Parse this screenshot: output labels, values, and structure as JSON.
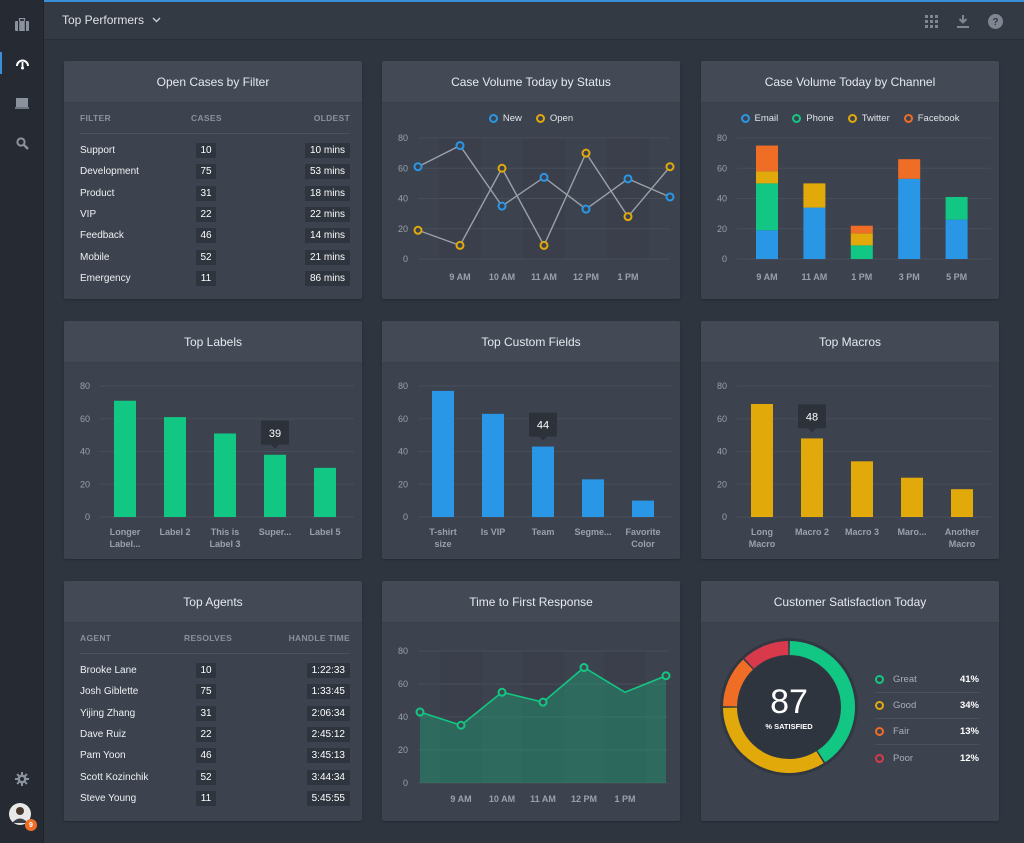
{
  "header": {
    "title": "Top Performers",
    "icons": [
      "grid-icon",
      "download-icon",
      "help-icon"
    ]
  },
  "sidebar": {
    "items": [
      {
        "name": "briefcase-icon",
        "active": false
      },
      {
        "name": "dashboard-gauge-icon",
        "active": true
      },
      {
        "name": "inbox-icon",
        "active": false
      },
      {
        "name": "search-icon",
        "active": false
      }
    ],
    "settings_icon": "gear-icon",
    "avatar_badge": "9"
  },
  "open_cases": {
    "title": "Open Cases by Filter",
    "columns": [
      "FILTER",
      "CASES",
      "OLDEST"
    ],
    "rows": [
      {
        "filter": "Support",
        "cases": "10",
        "oldest": "10 mins"
      },
      {
        "filter": "Development",
        "cases": "75",
        "oldest": "53 mins"
      },
      {
        "filter": "Product",
        "cases": "31",
        "oldest": "18 mins"
      },
      {
        "filter": "VIP",
        "cases": "22",
        "oldest": "22 mins"
      },
      {
        "filter": "Feedback",
        "cases": "46",
        "oldest": "14 mins"
      },
      {
        "filter": "Mobile",
        "cases": "52",
        "oldest": "21 mins"
      },
      {
        "filter": "Emergency",
        "cases": "11",
        "oldest": "86 mins"
      }
    ]
  },
  "top_agents": {
    "title": "Top Agents",
    "columns": [
      "AGENT",
      "RESOLVES",
      "HANDLE TIME"
    ],
    "rows": [
      {
        "agent": "Brooke Lane",
        "resolves": "10",
        "time": "1:22:33"
      },
      {
        "agent": "Josh Giblette",
        "resolves": "75",
        "time": "1:33:45"
      },
      {
        "agent": "Yijing Zhang",
        "resolves": "31",
        "time": "2:06:34"
      },
      {
        "agent": "Dave Ruiz",
        "resolves": "22",
        "time": "2:45:12"
      },
      {
        "agent": "Pam Yoon",
        "resolves": "46",
        "time": "3:45:13"
      },
      {
        "agent": "Scott Kozinchik",
        "resolves": "52",
        "time": "3:44:34"
      },
      {
        "agent": "Steve Young",
        "resolves": "11",
        "time": "5:45:55"
      }
    ]
  },
  "colors": {
    "blue": "#2a96e6",
    "green": "#12c783",
    "yellow": "#e2a90b",
    "orange": "#ef6d25",
    "red": "#d8394b",
    "line": "#9aa0a8"
  },
  "chart_data": [
    {
      "id": "status",
      "type": "line",
      "title": "Case Volume Today by Status",
      "x": [
        "",
        "9 AM",
        "10 AM",
        "11 AM",
        "12 PM",
        "1 PM",
        ""
      ],
      "ylim": [
        0,
        80
      ],
      "yticks": [
        0,
        20,
        40,
        60,
        80
      ],
      "legend": "top-center",
      "series": [
        {
          "name": "New",
          "color": "#2a96e6",
          "values": [
            61,
            75,
            35,
            54,
            33,
            53,
            41
          ]
        },
        {
          "name": "Open",
          "color": "#e2a90b",
          "values": [
            19,
            9,
            60,
            9,
            70,
            28,
            61
          ]
        }
      ]
    },
    {
      "id": "channel",
      "type": "bar",
      "stacked": true,
      "title": "Case Volume Today by Channel",
      "categories": [
        "9 AM",
        "11 AM",
        "1 PM",
        "3 PM",
        "5 PM"
      ],
      "ylim": [
        0,
        80
      ],
      "yticks": [
        0,
        20,
        40,
        60,
        80
      ],
      "legend": "top-center",
      "series": [
        {
          "name": "Email",
          "color": "#2a96e6",
          "values": [
            19,
            34,
            0,
            53,
            26
          ]
        },
        {
          "name": "Phone",
          "color": "#12c783",
          "values": [
            31,
            0,
            9,
            0,
            15
          ]
        },
        {
          "name": "Twitter",
          "color": "#e2a90b",
          "values": [
            8,
            16,
            8,
            0,
            0
          ]
        },
        {
          "name": "Facebook",
          "color": "#ef6d25",
          "values": [
            17,
            0,
            5,
            13,
            0
          ]
        }
      ]
    },
    {
      "id": "labels",
      "type": "bar",
      "title": "Top Labels",
      "categories": [
        [
          "Longer",
          "Label..."
        ],
        [
          "Label 2"
        ],
        [
          "This is",
          "Label 3"
        ],
        [
          "Super..."
        ],
        [
          "Label 5"
        ]
      ],
      "values": [
        71,
        61,
        51,
        38,
        30
      ],
      "color": "#12c783",
      "ylim": [
        0,
        80
      ],
      "yticks": [
        0,
        20,
        40,
        60,
        80
      ],
      "tooltip": {
        "index": 3,
        "text": "39"
      }
    },
    {
      "id": "fields",
      "type": "bar",
      "title": "Top Custom Fields",
      "categories": [
        [
          "T-shirt",
          "size"
        ],
        [
          "Is VIP"
        ],
        [
          "Team"
        ],
        [
          "Segme..."
        ],
        [
          "Favorite",
          "Color"
        ]
      ],
      "values": [
        77,
        63,
        43,
        23,
        10
      ],
      "color": "#2a96e6",
      "ylim": [
        0,
        80
      ],
      "yticks": [
        0,
        20,
        40,
        60,
        80
      ],
      "tooltip": {
        "index": 2,
        "text": "44"
      }
    },
    {
      "id": "macros",
      "type": "bar",
      "title": "Top Macros",
      "categories": [
        [
          "Long",
          "Macro"
        ],
        [
          "Macro 2"
        ],
        [
          "Macro 3"
        ],
        [
          "Maro..."
        ],
        [
          "Another",
          "Macro"
        ]
      ],
      "values": [
        69,
        48,
        34,
        24,
        17
      ],
      "color": "#e2a90b",
      "ylim": [
        0,
        80
      ],
      "yticks": [
        0,
        20,
        40,
        60,
        80
      ],
      "tooltip": {
        "index": 1,
        "text": "48"
      }
    },
    {
      "id": "response",
      "type": "area",
      "title": "Time to First Response",
      "x": [
        "",
        "9 AM",
        "10 AM",
        "11 AM",
        "12 PM",
        "1 PM",
        ""
      ],
      "values": [
        43,
        35,
        55,
        49,
        70,
        55,
        65
      ],
      "markers": [
        true,
        true,
        true,
        true,
        true,
        false,
        true
      ],
      "color": "#12c783",
      "ylim": [
        0,
        80
      ],
      "yticks": [
        0,
        20,
        40,
        60,
        80
      ]
    },
    {
      "id": "csat",
      "type": "pie",
      "title": "Customer Satisfaction Today",
      "center_value": "87",
      "center_label": "% SATISFIED",
      "slices": [
        {
          "name": "Great",
          "value": 41,
          "label": "41%",
          "color": "#12c783"
        },
        {
          "name": "Good",
          "value": 34,
          "label": "34%",
          "color": "#e2a90b"
        },
        {
          "name": "Fair",
          "value": 13,
          "label": "13%",
          "color": "#ef6d25"
        },
        {
          "name": "Poor",
          "value": 12,
          "label": "12%",
          "color": "#d8394b"
        }
      ]
    }
  ]
}
